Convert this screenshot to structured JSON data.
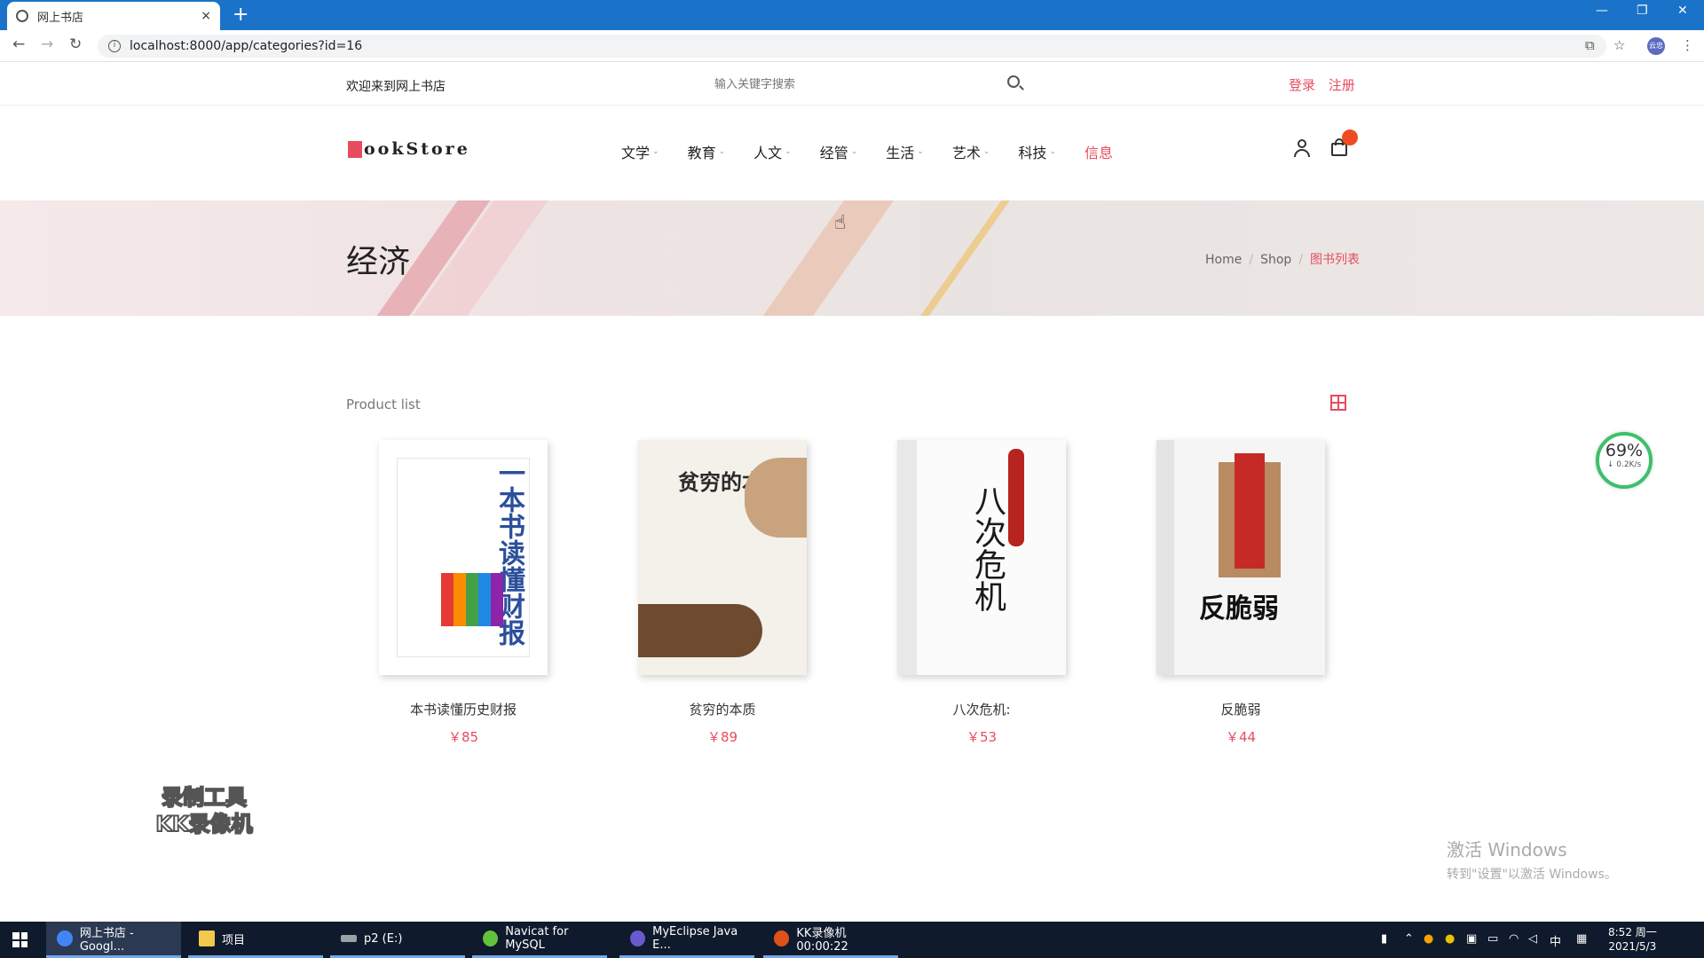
{
  "browser": {
    "tab_title": "网上书店",
    "tab_close": "×",
    "new_tab": "+",
    "url": "localhost:8000/app/categories?id=16",
    "profile_label": "云忠"
  },
  "topbar": {
    "welcome": "欢迎来到网上书店",
    "search_placeholder": "输入关键字搜索",
    "login": "登录",
    "register": "注册"
  },
  "header": {
    "logo_text": "ookStore",
    "nav": [
      {
        "label": "文学",
        "has_dropdown": true
      },
      {
        "label": "教育",
        "has_dropdown": true
      },
      {
        "label": "人文",
        "has_dropdown": true
      },
      {
        "label": "经管",
        "has_dropdown": true
      },
      {
        "label": "生活",
        "has_dropdown": true
      },
      {
        "label": "艺术",
        "has_dropdown": true
      },
      {
        "label": "科技",
        "has_dropdown": true
      },
      {
        "label": "信息",
        "has_dropdown": false
      }
    ],
    "chevron": "⌄"
  },
  "banner": {
    "title": "经济",
    "breadcrumb": [
      "Home",
      "Shop",
      "图书列表"
    ],
    "separator": "/"
  },
  "products": {
    "heading": "Product list",
    "items": [
      {
        "name": "本书读懂历史财报",
        "price": "￥85",
        "cover_text": "一本书读懂财报",
        "cover_color": "#ffffff",
        "accent": "#2b4f9c"
      },
      {
        "name": "贫穷的本质",
        "price": "￥89",
        "cover_text": "贫穷的本质",
        "cover_color": "#f4f0ea",
        "accent": "#2a2a2a"
      },
      {
        "name": "八次危机:",
        "price": "￥53",
        "cover_text": "八次危机",
        "cover_color": "#fbfbfb",
        "accent": "#b7231f"
      },
      {
        "name": "反脆弱",
        "price": "￥44",
        "cover_text": "反脆弱",
        "cover_color": "#f5f5f5",
        "accent": "#c62a26"
      }
    ]
  },
  "overlays": {
    "speed_pct": "69%",
    "speed_rate": "↓ 0.2K/s",
    "recorder_watermark_line1": "录制工具",
    "recorder_watermark_line2": "KK录像机",
    "activate_line1": "激活 Windows",
    "activate_line2": "转到\"设置\"以激活 Windows。"
  },
  "taskbar": {
    "tasks": [
      {
        "label": "网上书店 - Googl...",
        "color": "#4285f4"
      },
      {
        "label": "项目",
        "color": "#f2c94c"
      },
      {
        "label": "p2 (E:)",
        "color": "#9aa0a6"
      },
      {
        "label": "Navicat for MySQL",
        "color": "#63c13c"
      },
      {
        "label": "MyEclipse Java E...",
        "color": "#6a5acd"
      },
      {
        "label": "KK录像机 00:00:22",
        "color": "#e0501b"
      }
    ],
    "ime": "中",
    "time": "8:52 周一",
    "date": "2021/5/3"
  }
}
